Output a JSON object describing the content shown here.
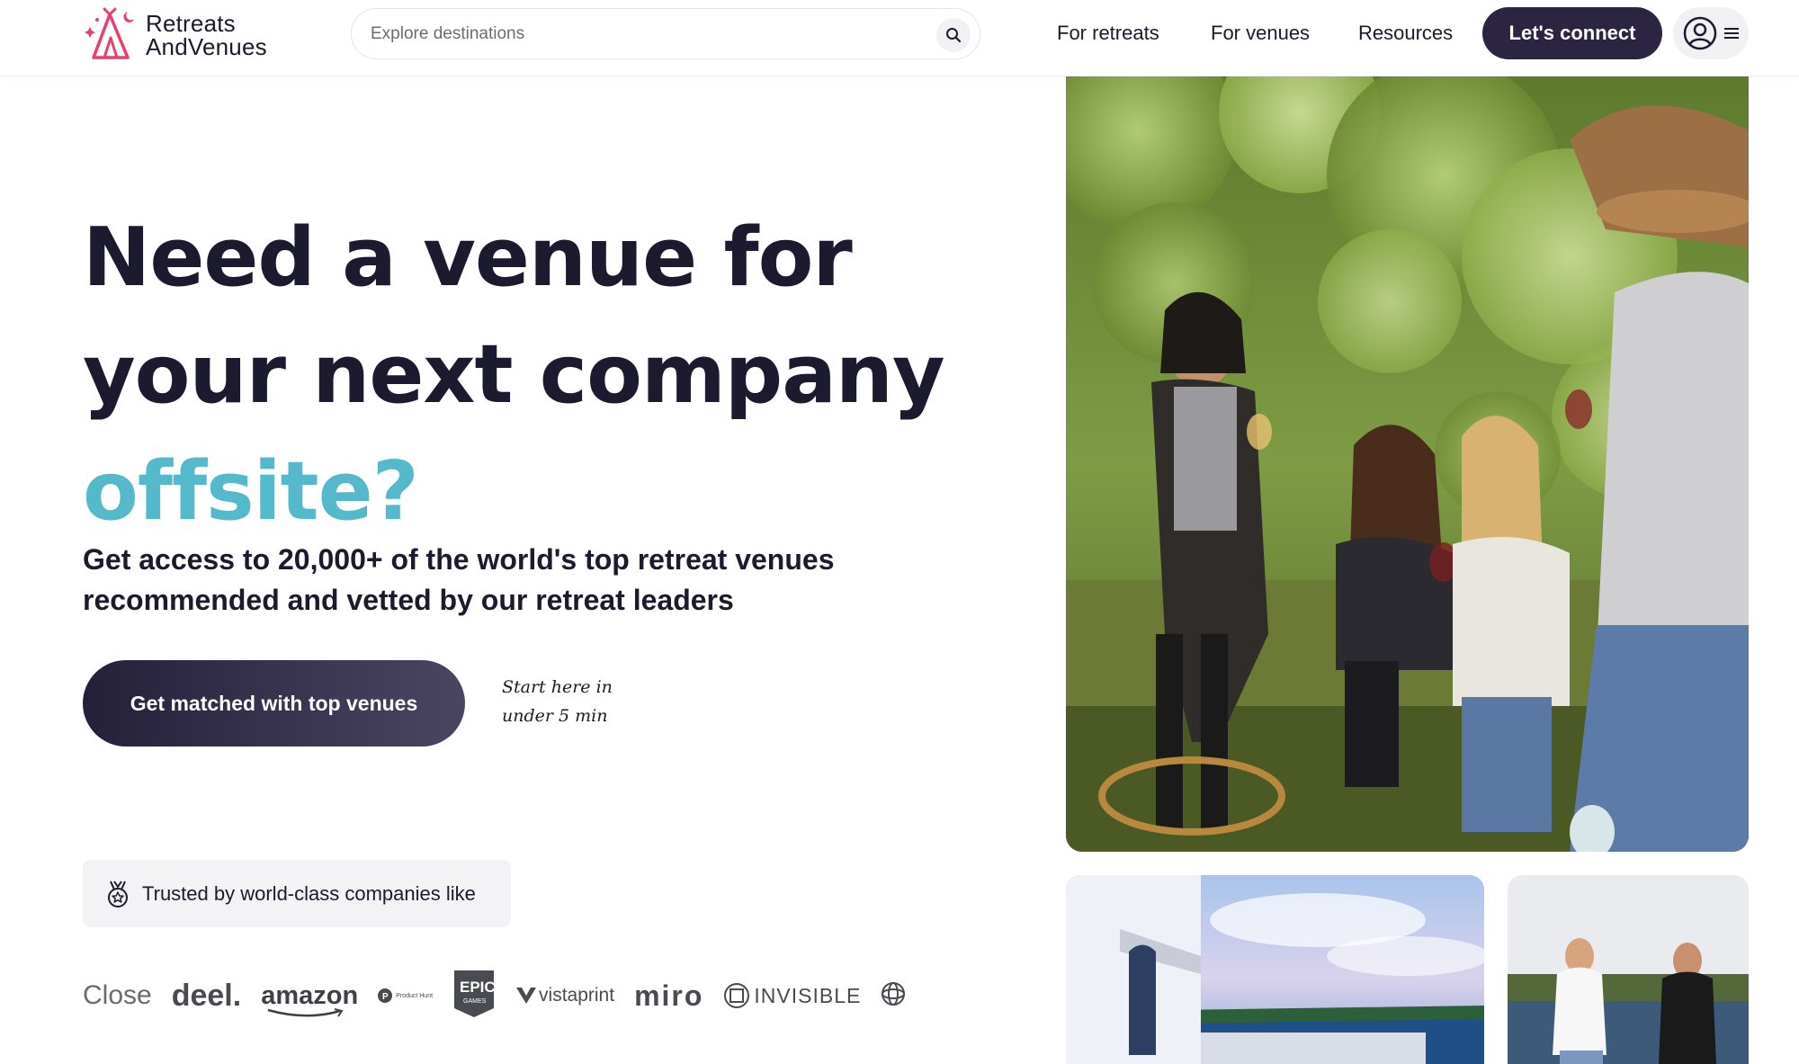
{
  "header": {
    "logo": {
      "line1": "Retreats",
      "line2": "AndVenues"
    },
    "search": {
      "placeholder": "Explore destinations"
    },
    "nav": [
      "For retreats",
      "For venues",
      "Resources"
    ],
    "cta_label": "Let's connect"
  },
  "hero": {
    "title_line1": "Need a venue for",
    "title_line2": "your next company",
    "title_accent": "offsite?",
    "subtitle_line1": "Get access to 20,000+ of the world's top retreat venues",
    "subtitle_line2": "recommended and vetted by our retreat leaders",
    "cta_label": "Get matched with top venues",
    "hint_line1": "Start here in",
    "hint_line2": "under 5 min"
  },
  "trusted": {
    "label": "Trusted by world-class companies like",
    "logos": [
      "Close",
      "deel.",
      "amazon",
      "Product Hunt",
      "EPIC GAMES",
      "vistaprint",
      "miro",
      "INVISIBLE"
    ]
  },
  "colors": {
    "navy": "#2b2541",
    "accent": "#55b9cc",
    "logo_pink": "#e8406b",
    "text": "#1c1a2e"
  }
}
